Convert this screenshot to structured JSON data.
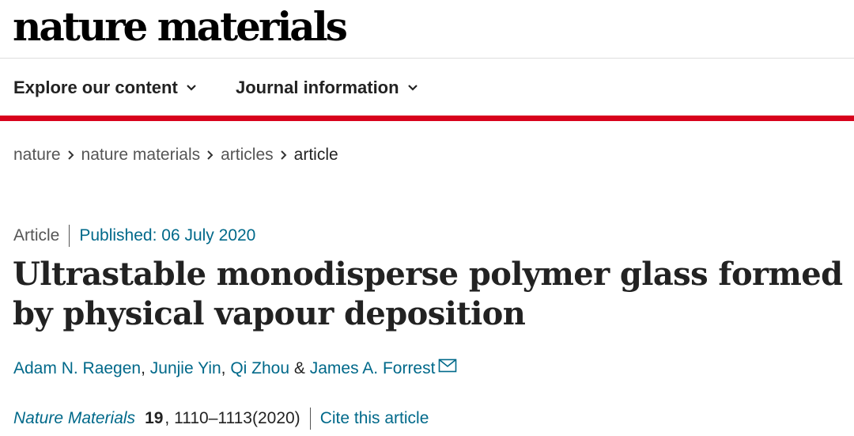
{
  "header": {
    "logo_text": "nature materials"
  },
  "nav": {
    "items": [
      {
        "label": "Explore our content"
      },
      {
        "label": "Journal information"
      }
    ]
  },
  "breadcrumb": {
    "items": [
      "nature",
      "nature materials",
      "articles",
      "article"
    ]
  },
  "article": {
    "type": "Article",
    "published": "Published: 06 July 2020",
    "title": "Ultrastable monodisperse polymer glass formed by physical vapour deposition",
    "authors": [
      {
        "name": "Adam N. Raegen",
        "sep": ", "
      },
      {
        "name": "Junjie Yin",
        "sep": ", "
      },
      {
        "name": "Qi Zhou",
        "sep": " & "
      },
      {
        "name": "James A. Forrest",
        "sep": ""
      }
    ],
    "citation": {
      "journal": "Nature Materials",
      "volume": "19",
      "pages": ", 1110–1113(2020)",
      "cite_label": "Cite this article"
    }
  },
  "colors": {
    "accent_red": "#d8021c",
    "link_blue": "#00698a",
    "text": "#222222",
    "muted": "#555555"
  },
  "icons": {
    "nav_chevron": "chevron-down-icon",
    "breadcrumb_separator": "chevron-right-icon",
    "author_contact": "mail-icon"
  }
}
